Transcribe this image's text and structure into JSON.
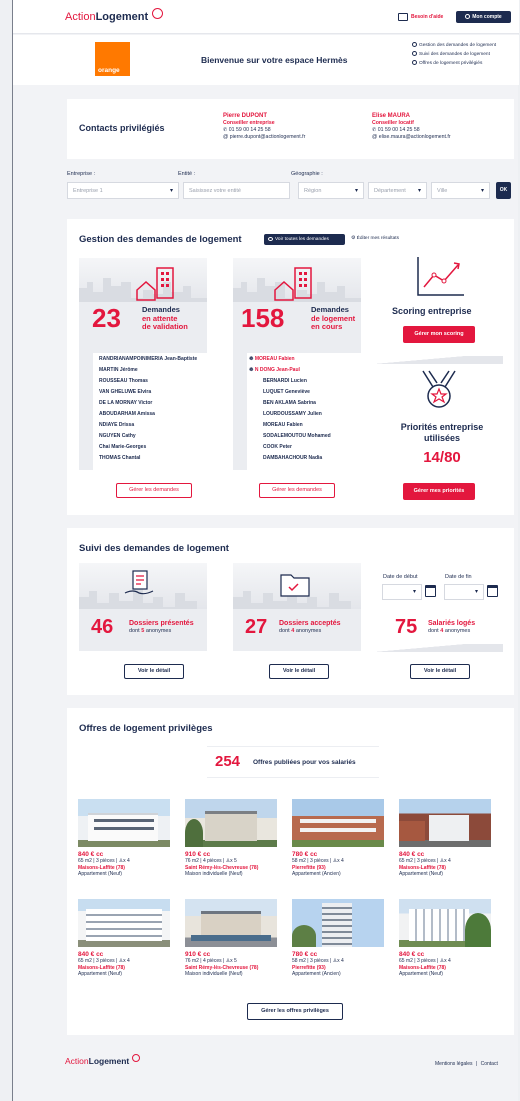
{
  "header": {
    "brand_action": "Action",
    "brand_logement": "Logement",
    "help_label": "Besoin d'aide",
    "account_label": "Mon compte"
  },
  "welcome": {
    "company_logo_text": "orange",
    "title": "Bienvenue sur votre espace Hermès",
    "links": [
      "Gestion des demandes de logement",
      "Suivi des demandes de logement",
      "Offres de logement privilégiés"
    ]
  },
  "contacts": {
    "title": "Contacts privilégiés",
    "people": [
      {
        "name": "Pierre DUPONT",
        "role": "Conseiller entreprise",
        "phone": "01 59 00 14 25 58",
        "email": "pierre.dupont@actionlogement.fr"
      },
      {
        "name": "Elise MAURA",
        "role": "Conseiller locatif",
        "phone": "01 59 00 14 25 58",
        "email": "elise.maura@actionlogement.fr"
      }
    ]
  },
  "filters": {
    "company_label": "Entreprise :",
    "company_value": "Entreprise 1",
    "entity_label": "Entité :",
    "entity_placeholder": "Saisissez votre entité",
    "geo_label": "Géographie :",
    "region_placeholder": "Région",
    "department_placeholder": "Département",
    "city_placeholder": "Ville",
    "ok_label": "OK"
  },
  "gestion": {
    "title": "Gestion des demandes de logement",
    "view_all_label": "Voir toutes les demandes",
    "edit_results_label": "Éditer mes résultats",
    "pending": {
      "count": "23",
      "label_line1": "Demandes",
      "label_line2": "en attente",
      "label_line3": "de validation",
      "names": [
        "RANDRIANAMPOINIMERIA Jean-Baptiste",
        "MARTIN Jérôme",
        "ROUSSEAU Thomas",
        "VAN GHELUWE Elvira",
        "DE LA MORNAY Victor",
        "ABOUDARHAM Amissa",
        "NDIAYE Drissa",
        "NGUYEN Cathy",
        "Chai Marie-Georges",
        "THOMAS Chantal"
      ],
      "button": "Gérer les demandes"
    },
    "ongoing": {
      "count": "158",
      "label_line1": "Demandes",
      "label_line2": "de logement",
      "label_line3": "en cours",
      "names_highlight": [
        "MOREAU Fabien",
        "N DONG Jean-Paul"
      ],
      "names": [
        "BERNARDI Lucien",
        "LUQUET Geneviève",
        "BEN AKLAMA Sabrina",
        "LOURDOUSSAMY Julien",
        "MOREAU Fabien",
        "SODALEMOUTOU Mohamed",
        "COOK Peter",
        "DAMBAHACHOUR Nadia"
      ],
      "button": "Gérer les demandes"
    },
    "scoring": {
      "title": "Scoring entreprise",
      "button": "Gérer mon scoring"
    },
    "priorities": {
      "title_line1": "Priorités entreprise",
      "title_line2": "utilisées",
      "value": "14/80",
      "button": "Gérer mes priorités"
    }
  },
  "suivi": {
    "title": "Suivi des demandes de logement",
    "date_start_label": "Date de début",
    "date_end_label": "Date de fin",
    "presented": {
      "count": "46",
      "label": "Dossiers présentés",
      "sub_prefix": "dont",
      "sub_count": "5",
      "sub_suffix": "anonymes",
      "button": "Voir le détail"
    },
    "accepted": {
      "count": "27",
      "label": "Dossiers acceptés",
      "sub_prefix": "dont",
      "sub_count": "4",
      "sub_suffix": "anonymes",
      "button": "Voir le détail"
    },
    "housed": {
      "count": "75",
      "label": "Salariés logés",
      "sub_prefix": "dont",
      "sub_count": "4",
      "sub_suffix": "anonymes",
      "button": "Voir le détail"
    }
  },
  "offres": {
    "title": "Offres de logement privilèges",
    "count": "254",
    "count_label": "Offres publiées pour vos salariés",
    "items": [
      {
        "price": "840 € cc",
        "details": "65 m2 | 3 pièces | ",
        "persons": "x 4",
        "location": "Maisons-Laffite (78)",
        "type": "Appartement (Neuf)"
      },
      {
        "price": "910 € cc",
        "details": "76 m2 | 4 pièces | ",
        "persons": "x 5",
        "location": "Saint Rémy-lès-Chevreuse (78)",
        "type": "Maison individuelle (Neuf)"
      },
      {
        "price": "780 € cc",
        "details": "58 m2 | 3 pièces | ",
        "persons": "x 4",
        "location": "Pierrefitte (93)",
        "type": "Appartement (Ancien)"
      },
      {
        "price": "840 € cc",
        "details": "65 m2 | 3 pièces | ",
        "persons": "x 4",
        "location": "Maisons-Laffite (78)",
        "type": "Appartement (Neuf)"
      },
      {
        "price": "840 € cc",
        "details": "65 m2 | 3 pièces | ",
        "persons": "x 4",
        "location": "Maisons-Laffite (78)",
        "type": "Appartement (Neuf)"
      },
      {
        "price": "910 € cc",
        "details": "76 m2 | 4 pièces | ",
        "persons": "x 5",
        "location": "Saint Rémy-lès-Chevreuse (78)",
        "type": "Maison individuelle (Neuf)"
      },
      {
        "price": "780 € cc",
        "details": "58 m2 | 3 pièces | ",
        "persons": "x 4",
        "location": "Pierrefitte (93)",
        "type": "Appartement (Ancien)"
      },
      {
        "price": "840 € cc",
        "details": "65 m2 | 3 pièces | ",
        "persons": "x 4",
        "location": "Maisons-Laffite (78)",
        "type": "Appartement (Neuf)"
      }
    ],
    "button": "Gérer les offres privilèges"
  },
  "footer": {
    "brand_action": "Action",
    "brand_logement": "Logement",
    "legal": "Mentions légales",
    "separator": "|",
    "contact": "Contact"
  },
  "colors": {
    "accent": "#e3173e",
    "navy": "#1d2b4f",
    "orange": "#ff7900"
  }
}
